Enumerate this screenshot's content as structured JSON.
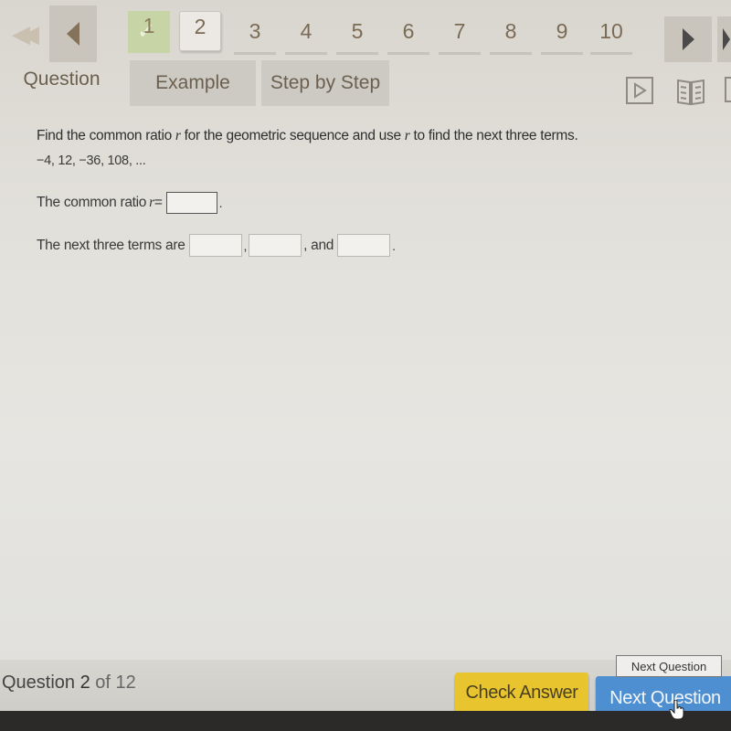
{
  "navigation": {
    "first_icon": "double-chevron-left-icon",
    "prev_icon": "triangle-left-icon",
    "next_icon": "triangle-right-icon",
    "last_icon": "triangle-right-bar-icon",
    "questions": [
      {
        "label": "1",
        "status": "completed"
      },
      {
        "label": "2",
        "status": "current"
      },
      {
        "label": "3",
        "status": "pending"
      },
      {
        "label": "4",
        "status": "pending"
      },
      {
        "label": "5",
        "status": "pending"
      },
      {
        "label": "6",
        "status": "pending"
      },
      {
        "label": "7",
        "status": "pending"
      },
      {
        "label": "8",
        "status": "pending"
      },
      {
        "label": "9",
        "status": "pending"
      },
      {
        "label": "10",
        "status": "pending"
      }
    ]
  },
  "tabs": [
    {
      "label": "Question",
      "active": true
    },
    {
      "label": "Example",
      "active": false
    },
    {
      "label": "Step by Step",
      "active": false
    }
  ],
  "tools": {
    "video_icon": "play-video-icon",
    "book_icon": "open-book-icon"
  },
  "problem": {
    "prompt_before_r": "Find the common ratio ",
    "var": "r",
    "prompt_middle": " for the geometric sequence and use ",
    "prompt_after": " to find the next three terms.",
    "sequence": "−4, 12, −36, 108, ...",
    "ratio_label": "The common ratio ",
    "ratio_eq": " =",
    "ratio_answer": "",
    "period": ".",
    "terms_label": "The next three terms are",
    "terms_answers": [
      "",
      "",
      ""
    ],
    "comma": ",",
    "and_label": ", and"
  },
  "footer": {
    "question_word": "Question ",
    "current": "2",
    "of_total": " of 12",
    "check_answer": "Check Answer",
    "next_question": "Next Question",
    "tooltip": "Next Question"
  },
  "colors": {
    "check_answer_bg": "#e8c52e",
    "next_question_bg": "#4d8fd0",
    "completed_bg": "#c7d4a6"
  }
}
